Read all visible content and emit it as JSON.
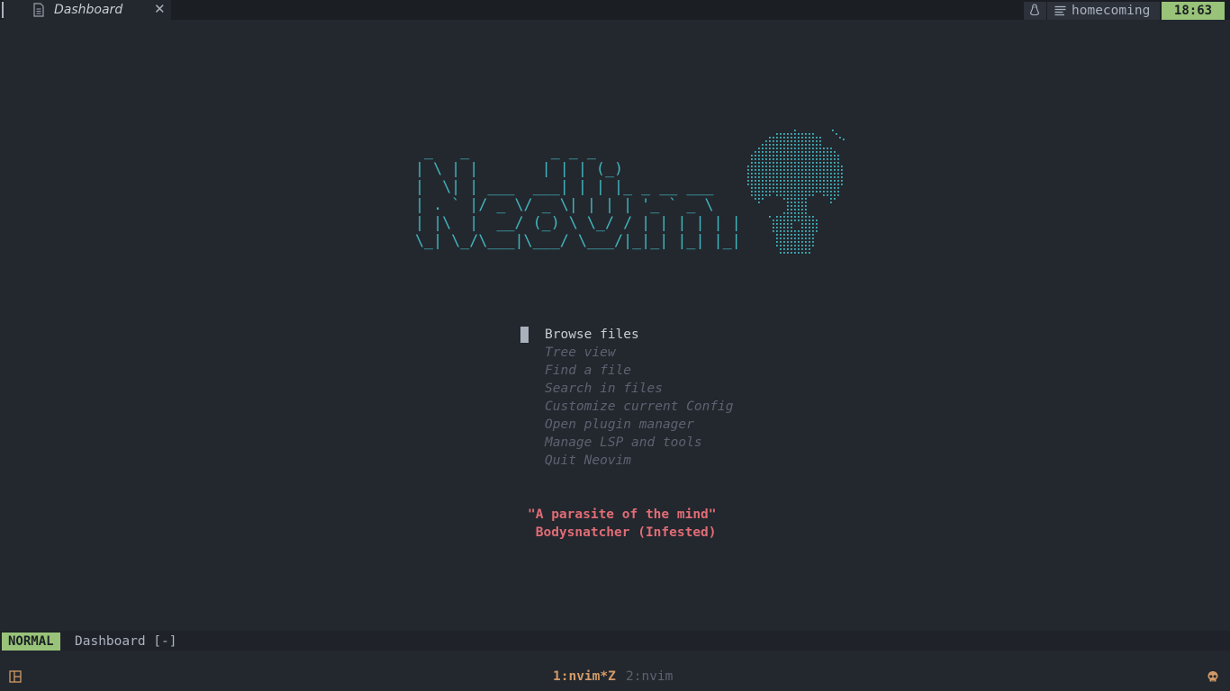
{
  "tabline": {
    "tab_title": "Dashboard",
    "tab_icon": "file-icon",
    "close_icon": "close-icon"
  },
  "header": {
    "ascii_art": " _   _         _ _ _\n| \\ | |       | | | (_)\n|  \\| | ___  ___| | | |_ _ __ ___\n| . ` |/ _ \\/ _ \\| | | | '_ ` _ \\\n| |\\  |  __/ (_) \\ \\_/ / | | | | | |\n\\_| \\_/\\___|\\___/ \\___/|_|_| |_| |_|",
    "logo_icon": "skull-icon"
  },
  "menu": {
    "items": [
      {
        "label": "Browse files"
      },
      {
        "label": "Tree view"
      },
      {
        "label": "Find a file"
      },
      {
        "label": "Search in files"
      },
      {
        "label": "Customize current Config"
      },
      {
        "label": "Open plugin manager"
      },
      {
        "label": "Manage LSP and tools"
      },
      {
        "label": "Quit Neovim"
      }
    ]
  },
  "footer": {
    "quote_line1": "\"A parasite of the mind\"",
    "quote_line2": " Bodysnatcher (Infested)"
  },
  "statusline": {
    "mode": "NORMAL",
    "file_info": "Dashboard [-]",
    "os_icon": "linux-icon",
    "branch_icon": "lines-icon",
    "branch": "homecoming",
    "position": "18:63"
  },
  "tmux": {
    "layout_icon": "layout-icon",
    "active_window": "1:nvim*Z",
    "inactive_window": "2:nvim",
    "status_icon": "skull-icon"
  },
  "colors": {
    "background": "#23272e",
    "accent_cyan": "#42b8c0",
    "mode_green": "#98c379",
    "quote_red": "#e06c75",
    "tmux_orange": "#d19a66"
  }
}
